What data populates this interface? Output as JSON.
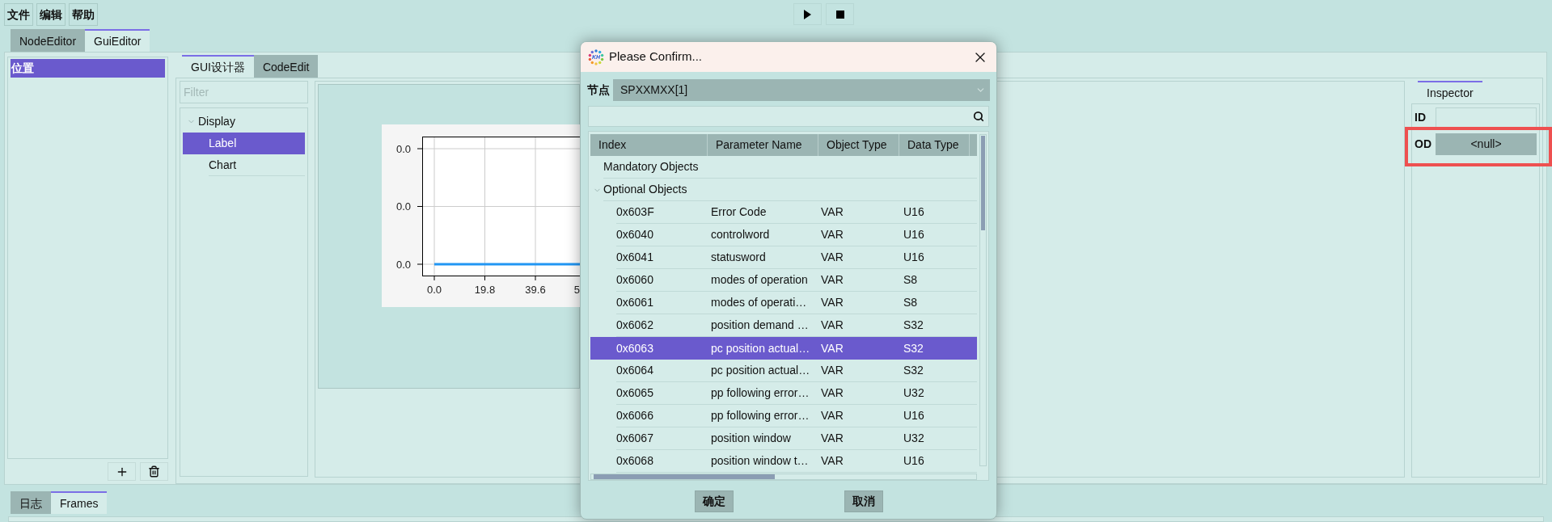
{
  "menu": [
    "文件",
    "编辑",
    "帮助"
  ],
  "main_tabs": [
    {
      "label": "NodeEditor",
      "selected": false
    },
    {
      "label": "GuiEditor",
      "selected": true
    }
  ],
  "pages": [
    {
      "label": "位置",
      "selected": true
    }
  ],
  "designer": {
    "tabs": [
      {
        "label": "GUI设计器",
        "selected": true
      },
      {
        "label": "CodeEdit",
        "selected": false
      }
    ],
    "filter": {
      "placeholder": "Filter"
    },
    "tree": [
      {
        "label": "Display",
        "expanded": true,
        "children": [
          {
            "label": "Label",
            "selected": true
          },
          {
            "label": "Chart",
            "selected": false
          }
        ]
      }
    ],
    "chart": {
      "y_tick_labels": [
        "0.0",
        "0.0",
        "0.0"
      ],
      "x_tick_labels": [
        "0.0",
        "19.8",
        "39.6",
        "5"
      ]
    }
  },
  "inspector": {
    "tabs": [
      {
        "label": "Inspector",
        "selected": true
      }
    ],
    "properties": [
      {
        "label": "ID",
        "kind": "field",
        "highlighted": false
      },
      {
        "label": "OD",
        "kind": "selector",
        "value": "<null>",
        "highlighted": true
      }
    ]
  },
  "bottom_tabs": [
    {
      "label": "日志",
      "selected": false
    },
    {
      "label": "Frames",
      "selected": true
    }
  ],
  "dialog": {
    "logo_text": "KH",
    "title": "Please Confirm...",
    "node": {
      "label": "节点",
      "value": "SPXXMXX[1]"
    },
    "columns": [
      "Index",
      "Parameter Name",
      "Object Type",
      "Data Type"
    ],
    "groups": [
      {
        "label": "Mandatory Objects"
      },
      {
        "label": "Optional Objects",
        "expanded": true,
        "rows": [
          {
            "index": "0x603F",
            "name": "Error Code",
            "object_type": "VAR",
            "data_type": "U16",
            "selected": false
          },
          {
            "index": "0x6040",
            "name": "controlword",
            "object_type": "VAR",
            "data_type": "U16",
            "selected": false
          },
          {
            "index": "0x6041",
            "name": "statusword",
            "object_type": "VAR",
            "data_type": "U16",
            "selected": false
          },
          {
            "index": "0x6060",
            "name": "modes of operation",
            "object_type": "VAR",
            "data_type": "S8",
            "selected": false
          },
          {
            "index": "0x6061",
            "name": "modes of operati…",
            "object_type": "VAR",
            "data_type": "S8",
            "selected": false
          },
          {
            "index": "0x6062",
            "name": "position demand …",
            "object_type": "VAR",
            "data_type": "S32",
            "selected": false
          },
          {
            "index": "0x6063",
            "name": "pc position actual…",
            "object_type": "VAR",
            "data_type": "S32",
            "selected": true
          },
          {
            "index": "0x6064",
            "name": "pc position actual…",
            "object_type": "VAR",
            "data_type": "S32",
            "selected": false
          },
          {
            "index": "0x6065",
            "name": "pp following error…",
            "object_type": "VAR",
            "data_type": "U32",
            "selected": false
          },
          {
            "index": "0x6066",
            "name": "pp following error…",
            "object_type": "VAR",
            "data_type": "U16",
            "selected": false
          },
          {
            "index": "0x6067",
            "name": "position window",
            "object_type": "VAR",
            "data_type": "U32",
            "selected": false
          },
          {
            "index": "0x6068",
            "name": "position window t…",
            "object_type": "VAR",
            "data_type": "U16",
            "selected": false
          }
        ]
      }
    ],
    "buttons": [
      "确定",
      "取消"
    ]
  }
}
